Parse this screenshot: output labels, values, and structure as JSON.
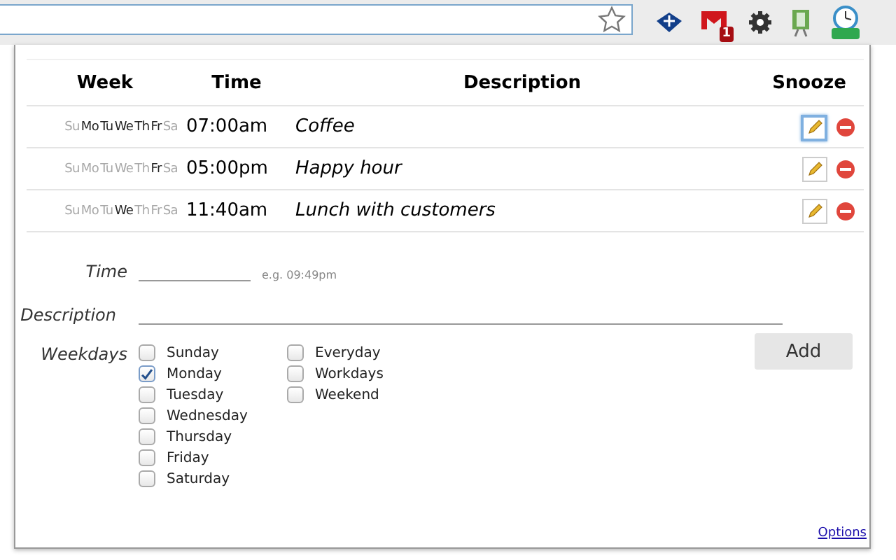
{
  "browser": {
    "gmail_badge": "1"
  },
  "table": {
    "columns": [
      "Week",
      "Time",
      "Description",
      "Snooze"
    ],
    "rows": [
      {
        "days": [
          {
            "label": "Su",
            "active": false
          },
          {
            "label": "Mo",
            "active": true
          },
          {
            "label": "Tu",
            "active": true
          },
          {
            "label": "We",
            "active": true
          },
          {
            "label": "Th",
            "active": true
          },
          {
            "label": "Fr",
            "active": true
          },
          {
            "label": "Sa",
            "active": false
          }
        ],
        "time": "07:00am",
        "description": "Coffee",
        "edit_selected": true
      },
      {
        "days": [
          {
            "label": "Su",
            "active": false
          },
          {
            "label": "Mo",
            "active": false
          },
          {
            "label": "Tu",
            "active": false
          },
          {
            "label": "We",
            "active": false
          },
          {
            "label": "Th",
            "active": false
          },
          {
            "label": "Fr",
            "active": true
          },
          {
            "label": "Sa",
            "active": false
          }
        ],
        "time": "05:00pm",
        "description": "Happy hour",
        "edit_selected": false
      },
      {
        "days": [
          {
            "label": "Su",
            "active": false
          },
          {
            "label": "Mo",
            "active": false
          },
          {
            "label": "Tu",
            "active": false
          },
          {
            "label": "We",
            "active": true
          },
          {
            "label": "Th",
            "active": false
          },
          {
            "label": "Fr",
            "active": false
          },
          {
            "label": "Sa",
            "active": false
          }
        ],
        "time": "11:40am",
        "description": "Lunch with customers",
        "edit_selected": false
      }
    ]
  },
  "form": {
    "time_label": "Time",
    "time_hint": "e.g. 09:49pm",
    "description_label": "Description",
    "weekdays_label": "Weekdays",
    "days": [
      {
        "label": "Sunday",
        "checked": false
      },
      {
        "label": "Monday",
        "checked": true
      },
      {
        "label": "Tuesday",
        "checked": false
      },
      {
        "label": "Wednesday",
        "checked": false
      },
      {
        "label": "Thursday",
        "checked": false
      },
      {
        "label": "Friday",
        "checked": false
      },
      {
        "label": "Saturday",
        "checked": false
      }
    ],
    "presets": [
      {
        "label": "Everyday",
        "checked": false
      },
      {
        "label": "Workdays",
        "checked": false
      },
      {
        "label": "Weekend",
        "checked": false
      }
    ],
    "add_button": "Add"
  },
  "options_link": "Options"
}
